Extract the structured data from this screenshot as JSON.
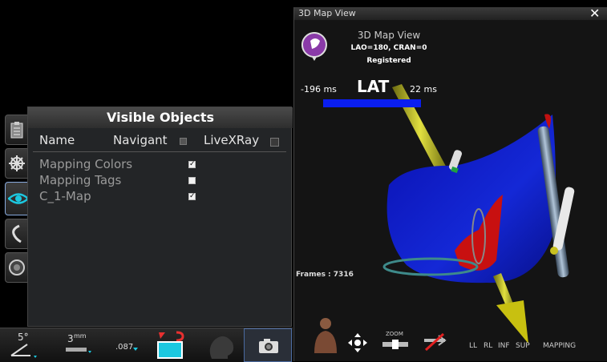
{
  "left_panel": {
    "title": "Visible Objects",
    "columns": {
      "name": "Name",
      "navigant": "Navigant",
      "livexray": "LiveXRay"
    },
    "rows": [
      {
        "label": "Mapping Colors",
        "navigant_checked": true
      },
      {
        "label": "Mapping Tags",
        "navigant_checked": false
      },
      {
        "label": "C_1-Map",
        "navigant_checked": true
      }
    ]
  },
  "side_tabs": [
    "clipboard-icon",
    "wheel-icon",
    "eye-icon",
    "catheter-icon",
    "dial-icon"
  ],
  "toolbar": {
    "angle_value": "5°",
    "step_value": "3",
    "step_unit": "mm",
    "wire_value": ".087"
  },
  "map_view": {
    "window_title": "3D Map View",
    "header_title": "3D Map View",
    "orientation": "LAO=180, CRAN=0",
    "status": "Registered",
    "lat_min": "-196 ms",
    "lat_label": "LAT",
    "lat_max": "22 ms",
    "frames": "Frames : 7316",
    "zoom_label": "ZOOM",
    "view_buttons": [
      "LL",
      "RL",
      "INF",
      "SUP",
      "MAPPING"
    ]
  },
  "colors": {
    "map_blue": "#1020c8",
    "scale_blue": "#0a1ef0",
    "accent_cyan": "#1cc8e0",
    "badge_purple": "#8a3aa8"
  }
}
